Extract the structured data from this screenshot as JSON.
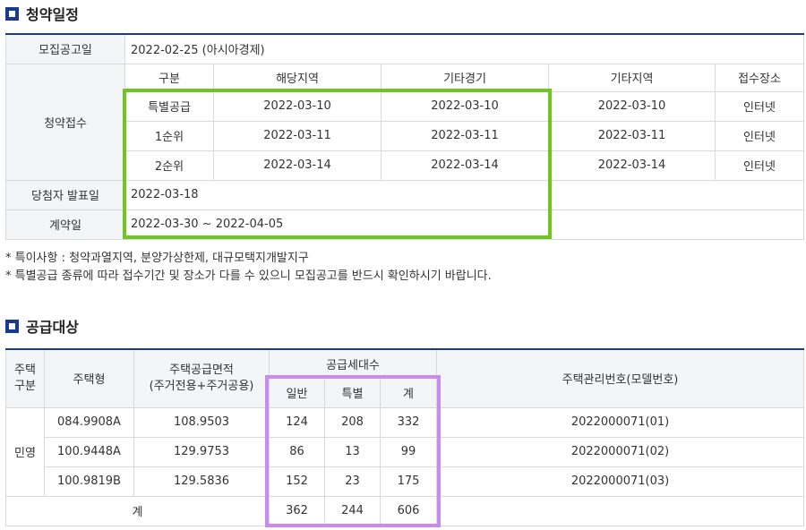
{
  "section1": {
    "title": "청약일정",
    "notice_label": "모집공고일",
    "notice_value": "2022-02-25 (아시아경제)",
    "receipt_label": "청약접수",
    "headers": [
      "구분",
      "해당지역",
      "기타경기",
      "기타지역",
      "접수장소"
    ],
    "rows": [
      [
        "특별공급",
        "2022-03-10",
        "2022-03-10",
        "2022-03-10",
        "인터넷"
      ],
      [
        "1순위",
        "2022-03-11",
        "2022-03-11",
        "2022-03-11",
        "인터넷"
      ],
      [
        "2순위",
        "2022-03-14",
        "2022-03-14",
        "2022-03-14",
        "인터넷"
      ]
    ],
    "winner_label": "당첨자 발표일",
    "winner_value": "2022-03-18",
    "contract_label": "계약일",
    "contract_value": "2022-03-30 ~ 2022-04-05"
  },
  "notes": [
    "* 특이사항 : 청약과열지역, 분양가상한제, 대규모택지개발지구",
    "* 특별공급 종류에 따라 접수기간 및 장소가 다를 수 있으니 모집공고를 반드시 확인하시기 바랍니다."
  ],
  "section2": {
    "title": "공급대상",
    "headers": {
      "type": "주택\n구분",
      "model": "주택형",
      "area_line1": "주택공급면적",
      "area_line2": "(주거전용+주거공용)",
      "units": "공급세대수",
      "general": "일반",
      "special": "특별",
      "total": "계",
      "mgmt": "주택관리번호(모델번호)"
    },
    "category": "민영",
    "rows": [
      {
        "model": "084.9908A",
        "area": "108.9503",
        "general": "124",
        "special": "208",
        "total": "332",
        "mgmt": "2022000071(01)"
      },
      {
        "model": "100.9448A",
        "area": "129.9753",
        "general": "86",
        "special": "13",
        "total": "99",
        "mgmt": "2022000071(02)"
      },
      {
        "model": "100.9819B",
        "area": "129.5836",
        "general": "152",
        "special": "23",
        "total": "175",
        "mgmt": "2022000071(03)"
      }
    ],
    "sum_label": "계",
    "sum_general": "362",
    "sum_special": "244",
    "sum_total": "606"
  },
  "colors": {
    "accent": "#1a3a8f",
    "highlight_green": "#6ec71f",
    "highlight_purple": "#c98bf2"
  }
}
